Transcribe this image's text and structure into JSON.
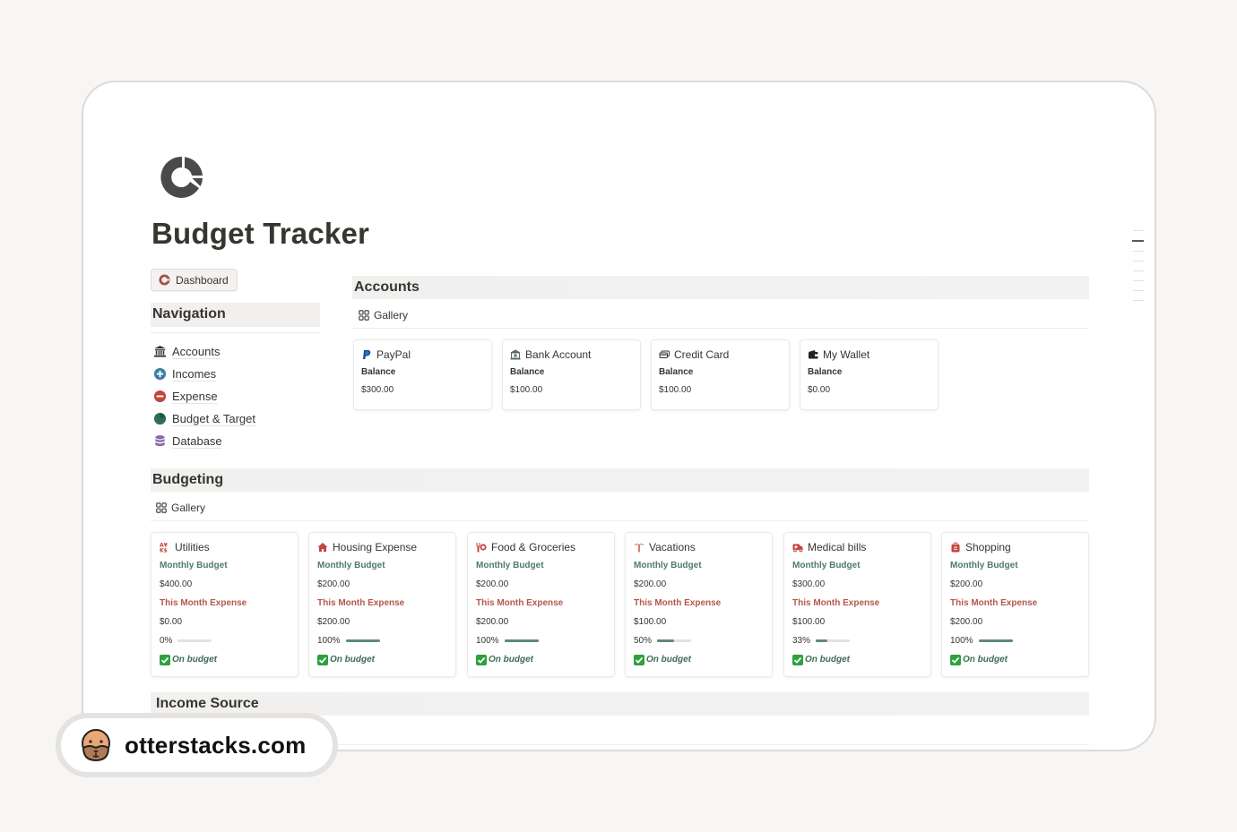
{
  "page": {
    "title": "Budget Tracker"
  },
  "dashboard_button": {
    "label": "Dashboard"
  },
  "navigation": {
    "heading": "Navigation",
    "items": [
      {
        "label": "Accounts",
        "icon": "bank-icon"
      },
      {
        "label": "Incomes",
        "icon": "plus-circle-icon"
      },
      {
        "label": "Expense",
        "icon": "minus-circle-icon"
      },
      {
        "label": "Budget & Target",
        "icon": "pie-chart-icon"
      },
      {
        "label": "Database",
        "icon": "database-icon"
      }
    ]
  },
  "accounts": {
    "heading": "Accounts",
    "view_tab": "Gallery",
    "cards": [
      {
        "name": "PayPal",
        "icon": "paypal-icon",
        "balance_label": "Balance",
        "balance": "$300.00"
      },
      {
        "name": "Bank Account",
        "icon": "bank-icon",
        "balance_label": "Balance",
        "balance": "$100.00"
      },
      {
        "name": "Credit Card",
        "icon": "credit-card-icon",
        "balance_label": "Balance",
        "balance": "$100.00"
      },
      {
        "name": "My Wallet",
        "icon": "wallet-icon",
        "balance_label": "Balance",
        "balance": "$0.00"
      }
    ]
  },
  "budgeting": {
    "heading": "Budgeting",
    "view_tab": "Gallery",
    "cards": [
      {
        "name": "Utilities",
        "icon": "utilities-icon",
        "budget_label": "Monthly Budget",
        "budget": "$400.00",
        "expense_label": "This Month Expense",
        "expense": "$0.00",
        "percent_label": "0%",
        "percent": 0,
        "status": "On budget"
      },
      {
        "name": "Housing Expense",
        "icon": "house-icon",
        "budget_label": "Monthly Budget",
        "budget": "$200.00",
        "expense_label": "This Month Expense",
        "expense": "$200.00",
        "percent_label": "100%",
        "percent": 100,
        "status": "On budget"
      },
      {
        "name": "Food & Groceries",
        "icon": "food-icon",
        "budget_label": "Monthly Budget",
        "budget": "$200.00",
        "expense_label": "This Month Expense",
        "expense": "$200.00",
        "percent_label": "100%",
        "percent": 100,
        "status": "On budget"
      },
      {
        "name": "Vacations",
        "icon": "palm-tree-icon",
        "budget_label": "Monthly Budget",
        "budget": "$200.00",
        "expense_label": "This Month Expense",
        "expense": "$100.00",
        "percent_label": "50%",
        "percent": 50,
        "status": "On budget"
      },
      {
        "name": "Medical bills",
        "icon": "ambulance-icon",
        "budget_label": "Monthly Budget",
        "budget": "$300.00",
        "expense_label": "This Month Expense",
        "expense": "$100.00",
        "percent_label": "33%",
        "percent": 33,
        "status": "On budget"
      },
      {
        "name": "Shopping",
        "icon": "shopping-bag-icon",
        "budget_label": "Monthly Budget",
        "budget": "$200.00",
        "expense_label": "This Month Expense",
        "expense": "$200.00",
        "percent_label": "100%",
        "percent": 100,
        "status": "On budget"
      }
    ]
  },
  "income_source": {
    "heading": "Income Source"
  },
  "watermark": {
    "text": "otterstacks.com",
    "icon": "otter-icon"
  },
  "colors": {
    "budget_label": "#4f7b6a",
    "expense_label": "#b4574d",
    "progress_fill": "#5f8a76",
    "status_check": "#2ea13d"
  }
}
